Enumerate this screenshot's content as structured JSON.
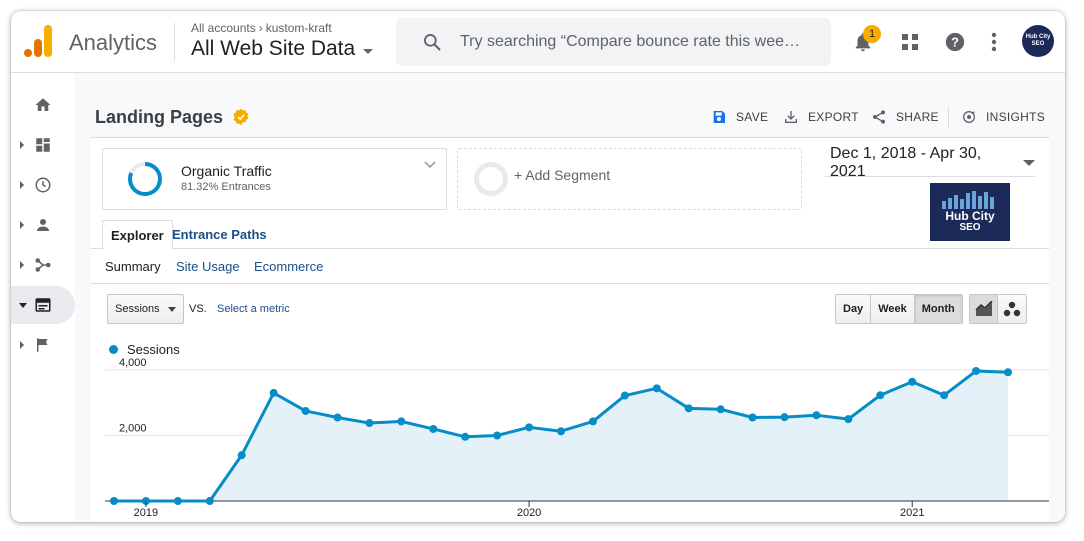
{
  "topbar": {
    "app_name": "Analytics",
    "breadcrumb": {
      "account": "All accounts",
      "property": "kustom-kraft"
    },
    "view_name": "All Web Site Data",
    "search_placeholder": "Try searching “Compare bounce rate this wee…",
    "notification_count": "1",
    "avatar_text": "Hub City SEO"
  },
  "sidebar": {
    "items": [
      {
        "name": "home-icon",
        "active": false,
        "expandable": false
      },
      {
        "name": "customization-icon",
        "active": false,
        "expandable": true
      },
      {
        "name": "realtime-icon",
        "active": false,
        "expandable": true
      },
      {
        "name": "audience-icon",
        "active": false,
        "expandable": true
      },
      {
        "name": "acquisition-icon",
        "active": false,
        "expandable": true
      },
      {
        "name": "behavior-icon",
        "active": true,
        "expandable": true
      },
      {
        "name": "conversions-icon",
        "active": false,
        "expandable": true
      }
    ]
  },
  "page": {
    "title": "Landing Pages",
    "actions": {
      "save": "SAVE",
      "export": "EXPORT",
      "share": "SHARE",
      "insights": "INSIGHTS"
    }
  },
  "segment": {
    "name": "Organic Traffic",
    "detail": "81.32% Entrances",
    "percent": 81.32,
    "color": "#058dc7"
  },
  "add_segment_label": "+ Add Segment",
  "date_range": "Dec 1, 2018 - Apr 30, 2021",
  "brand_logo": {
    "line1": "Hub City",
    "line2": "SEO"
  },
  "tabs": {
    "explorer": "Explorer",
    "entrance_paths": "Entrance Paths"
  },
  "subnav": {
    "summary": "Summary",
    "site_usage": "Site Usage",
    "ecommerce": "Ecommerce"
  },
  "controls": {
    "metric": "Sessions",
    "vs": "VS.",
    "select_metric": "Select a metric",
    "granularity": [
      "Day",
      "Week",
      "Month"
    ],
    "granularity_selected": "Month"
  },
  "chart_data": {
    "type": "area",
    "series": [
      {
        "name": "Sessions",
        "color": "#058dc7",
        "x": [
          "2018-12",
          "2019-01",
          "2019-02",
          "2019-03",
          "2019-04",
          "2019-05",
          "2019-06",
          "2019-07",
          "2019-08",
          "2019-09",
          "2019-10",
          "2019-11",
          "2019-12",
          "2020-01",
          "2020-02",
          "2020-03",
          "2020-04",
          "2020-05",
          "2020-06",
          "2020-07",
          "2020-08",
          "2020-09",
          "2020-10",
          "2020-11",
          "2020-12",
          "2021-01",
          "2021-02",
          "2021-03",
          "2021-04"
        ],
        "values": [
          0,
          0,
          0,
          0,
          1400,
          3300,
          2750,
          2550,
          2380,
          2430,
          2200,
          1960,
          2000,
          2250,
          2130,
          2430,
          3220,
          3440,
          2830,
          2800,
          2550,
          2560,
          2620,
          2500,
          3230,
          3640,
          3230,
          3970,
          3930
        ]
      }
    ],
    "yticks": [
      2000,
      4000
    ],
    "ytick_labels": [
      "2,000",
      "4,000"
    ],
    "ylim": [
      0,
      4000
    ],
    "xtick_labels": [
      "2019",
      "2020",
      "2021"
    ],
    "legend": "top-left",
    "grid": true
  }
}
